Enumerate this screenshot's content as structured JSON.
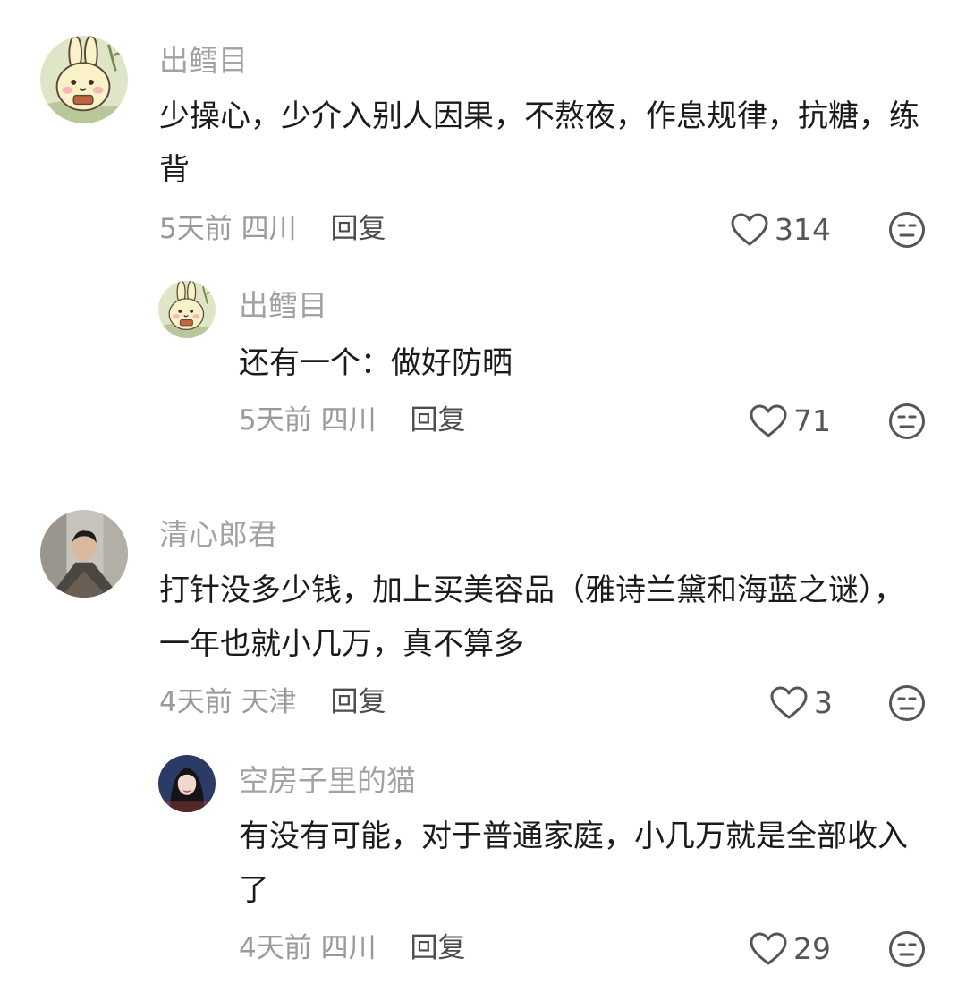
{
  "comments": [
    {
      "username": "出鳕目",
      "text": "少操心，少介入别人因果，不熬夜，作息规律，抗糖，练背",
      "time": "5天前",
      "location": "四川",
      "reply_label": "回复",
      "likes": "314",
      "avatar_icon": "rabbit-avatar-icon",
      "replies": [
        {
          "username": "出鳕目",
          "text": "还有一个：做好防晒",
          "time": "5天前",
          "location": "四川",
          "reply_label": "回复",
          "likes": "71",
          "avatar_icon": "rabbit-avatar-icon"
        }
      ]
    },
    {
      "username": "清心郎君",
      "text": "打针没多少钱，加上买美容品（雅诗兰黛和海蓝之谜），一年也就小几万，真不算多",
      "time": "4天前",
      "location": "天津",
      "reply_label": "回复",
      "likes": "3",
      "avatar_icon": "man-photo-avatar-icon",
      "replies": [
        {
          "username": "空房子里的猫",
          "text": "有没有可能，对于普通家庭，小几万就是全部收入了",
          "time": "4天前",
          "location": "四川",
          "reply_label": "回复",
          "likes": "29",
          "avatar_icon": "woman-photo-avatar-icon"
        }
      ]
    }
  ],
  "colors": {
    "username": "#a2a2a2",
    "text": "#1b1b1b",
    "meta": "#9a9a9a",
    "reply": "#4d4d4d",
    "icon": "#555555"
  }
}
